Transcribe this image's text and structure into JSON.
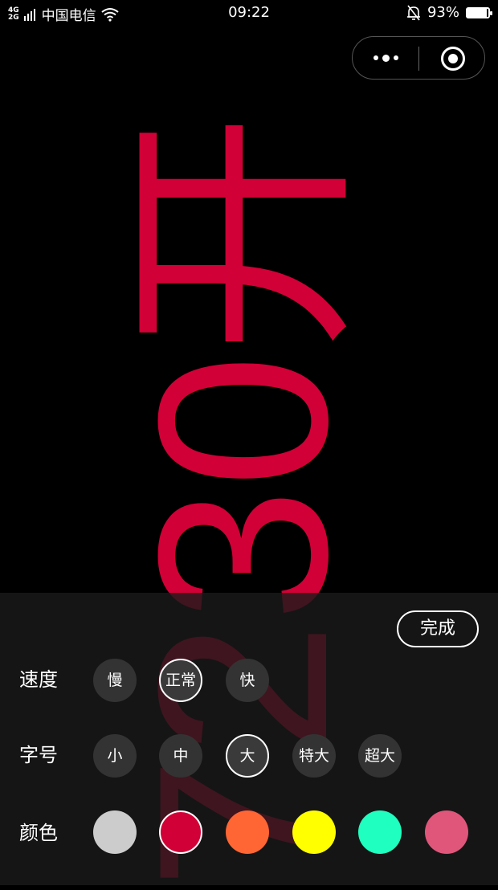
{
  "status_bar": {
    "network_type": "4G/2G",
    "carrier": "中国电信",
    "time": "09:22",
    "battery": "93%",
    "battery_level": 0.93
  },
  "marquee": {
    "text": "7230开",
    "color": "#d10036"
  },
  "panel": {
    "done_label": "完成",
    "speed": {
      "label": "速度",
      "options": [
        "慢",
        "正常",
        "快"
      ],
      "selected": "正常"
    },
    "font_size": {
      "label": "字号",
      "options": [
        "小",
        "中",
        "大",
        "特大",
        "超大"
      ],
      "selected": "大"
    },
    "color": {
      "label": "颜色",
      "swatches": [
        "#cccccc",
        "#d10036",
        "#ff6633",
        "#ffff00",
        "#1fffbf",
        "#e0567a"
      ],
      "selected": "#d10036"
    }
  }
}
